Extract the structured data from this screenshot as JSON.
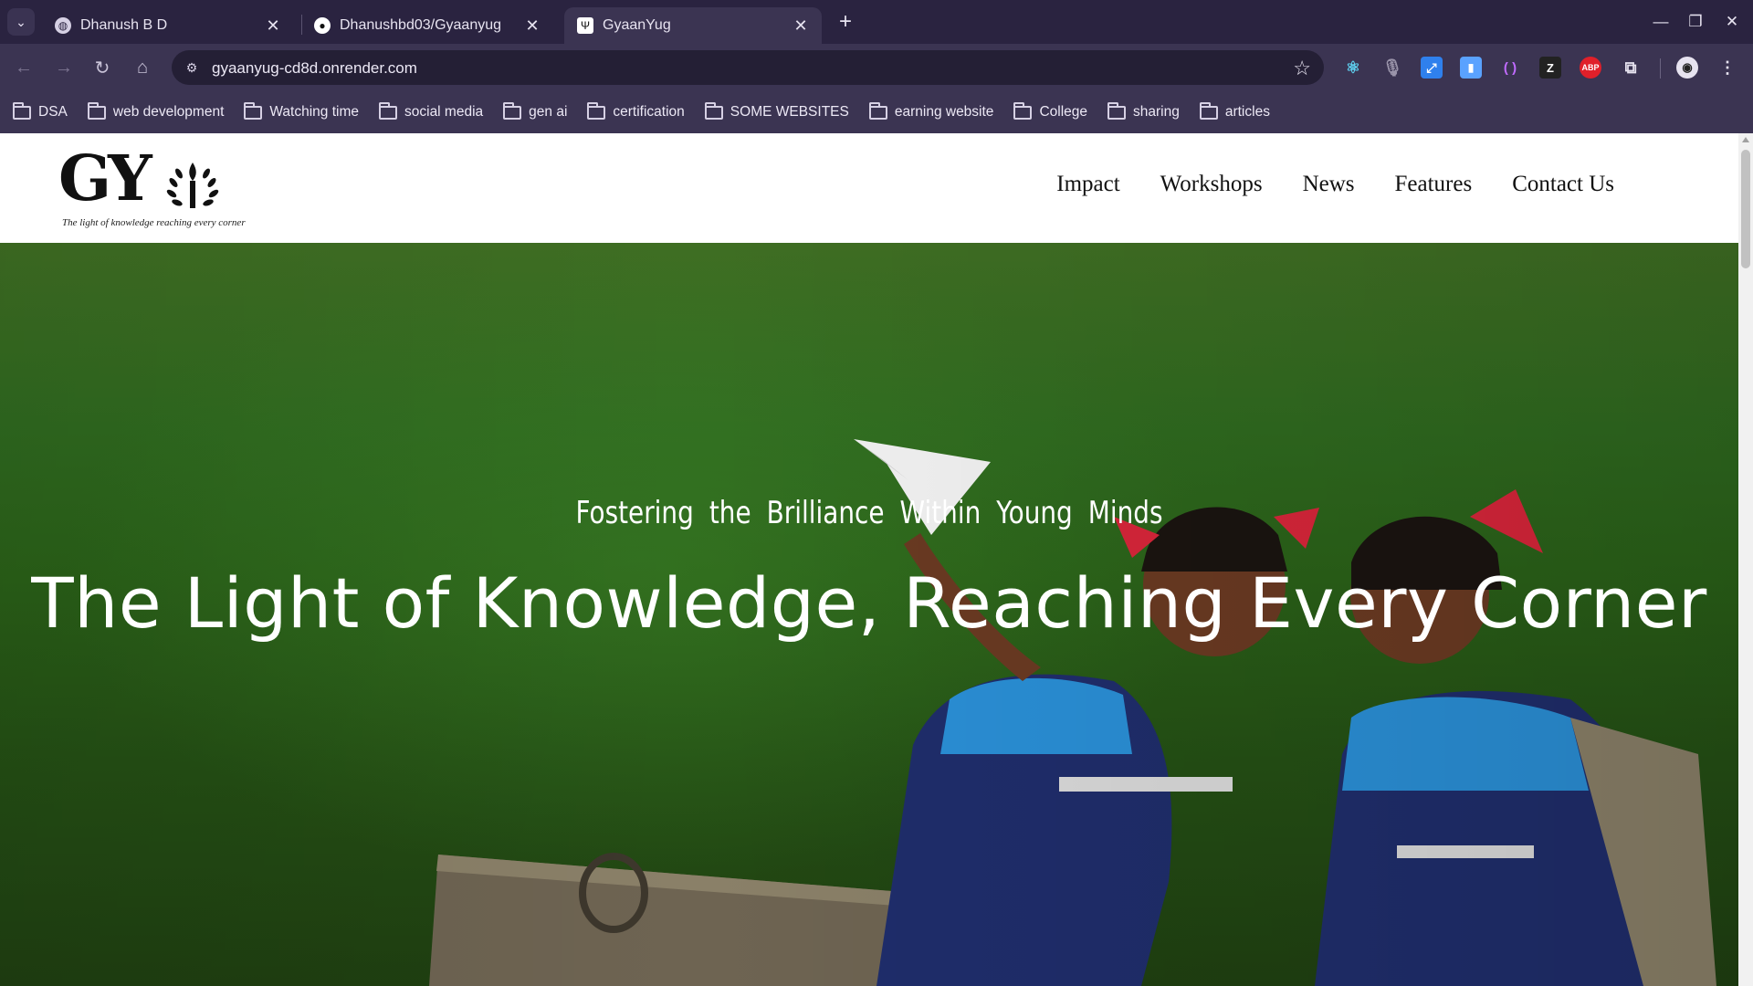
{
  "browser": {
    "tabs": [
      {
        "title": "Dhanush B D",
        "favicon": "globe-icon",
        "active": false
      },
      {
        "title": "Dhanushbd03/Gyaanyug",
        "favicon": "github-icon",
        "active": false
      },
      {
        "title": "GyaanYug",
        "favicon": "gyaanyug-logo-icon",
        "active": true
      }
    ],
    "url": "gyaanyug-cd8d.onrender.com",
    "bookmarks": [
      "DSA",
      "web development",
      "Watching time",
      "social media",
      "gen ai",
      "certification",
      "SOME WEBSITES",
      "earning website",
      "College",
      "sharing",
      "articles"
    ],
    "extensions": [
      {
        "name": "react-devtools-icon",
        "color": "#5fd3f3"
      },
      {
        "name": "microphone-icon",
        "color": "#9a94aa"
      },
      {
        "name": "resize-extension-icon",
        "color": "#2f80ed"
      },
      {
        "name": "document-extension-icon",
        "color": "#5aa2ff"
      },
      {
        "name": "brackets-extension-icon",
        "color": "#c06bff"
      },
      {
        "name": "dark-extension-icon",
        "color": "#222222"
      },
      {
        "name": "adblock-plus-icon",
        "label": "ABP",
        "color": "#e0202a"
      },
      {
        "name": "extensions-puzzle-icon",
        "color": "#e7e3f0"
      }
    ]
  },
  "site": {
    "logo": {
      "mark": "GY",
      "tagline": "The light of knowledge reaching every corner"
    },
    "nav": [
      "Impact",
      "Workshops",
      "News",
      "Features",
      "Contact Us"
    ],
    "hero": {
      "subtitle": "Fostering the Brilliance Within Young Minds",
      "title": "The Light of Knowledge, Reaching Every Corner"
    }
  }
}
